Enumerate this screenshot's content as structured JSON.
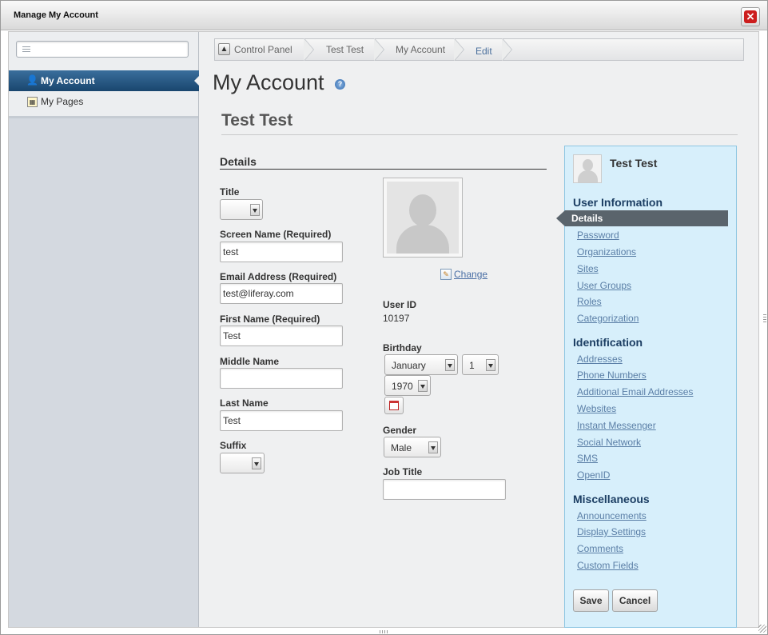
{
  "window": {
    "title": "Manage My Account",
    "close_label": "×"
  },
  "sidebar": {
    "search_placeholder": "",
    "items": [
      {
        "label": "My Account",
        "icon": "user-icon",
        "active": true
      },
      {
        "label": "My Pages",
        "icon": "pages-icon",
        "active": false
      }
    ]
  },
  "breadcrumb": [
    "Control Panel",
    "Test Test",
    "My Account",
    "Edit"
  ],
  "page": {
    "title": "My Account",
    "help_label": "?",
    "user_name": "Test Test"
  },
  "details": {
    "section_title": "Details",
    "title_label": "Title",
    "title_value": "",
    "screen_name_label": "Screen Name (Required)",
    "screen_name_value": "test",
    "email_label": "Email Address (Required)",
    "email_value": "test@liferay.com",
    "first_name_label": "First Name (Required)",
    "first_name_value": "Test",
    "middle_name_label": "Middle Name",
    "middle_name_value": "",
    "last_name_label": "Last Name",
    "last_name_value": "Test",
    "suffix_label": "Suffix",
    "suffix_value": "",
    "change_label": "Change",
    "user_id_label": "User ID",
    "user_id_value": "10197",
    "birthday_label": "Birthday",
    "birthday_month": "January",
    "birthday_day": "1",
    "birthday_year": "1970",
    "gender_label": "Gender",
    "gender_value": "Male",
    "job_title_label": "Job Title",
    "job_title_value": ""
  },
  "side_menu": {
    "user_name": "Test Test",
    "user_information": {
      "heading": "User Information",
      "selected": "Details",
      "links": [
        "Password",
        "Organizations",
        "Sites",
        "User Groups",
        "Roles",
        "Categorization"
      ]
    },
    "identification": {
      "heading": "Identification",
      "links": [
        "Addresses",
        "Phone Numbers",
        "Additional Email Addresses",
        "Websites",
        "Instant Messenger",
        "Social Network",
        "SMS",
        "OpenID"
      ]
    },
    "miscellaneous": {
      "heading": "Miscellaneous",
      "links": [
        "Announcements",
        "Display Settings",
        "Comments",
        "Custom Fields"
      ]
    },
    "save_label": "Save",
    "cancel_label": "Cancel"
  },
  "colors": {
    "accent": "#19466e",
    "menu_bg": "#d7effb",
    "link": "#5a7ea6",
    "close": "#cc1d1d"
  }
}
